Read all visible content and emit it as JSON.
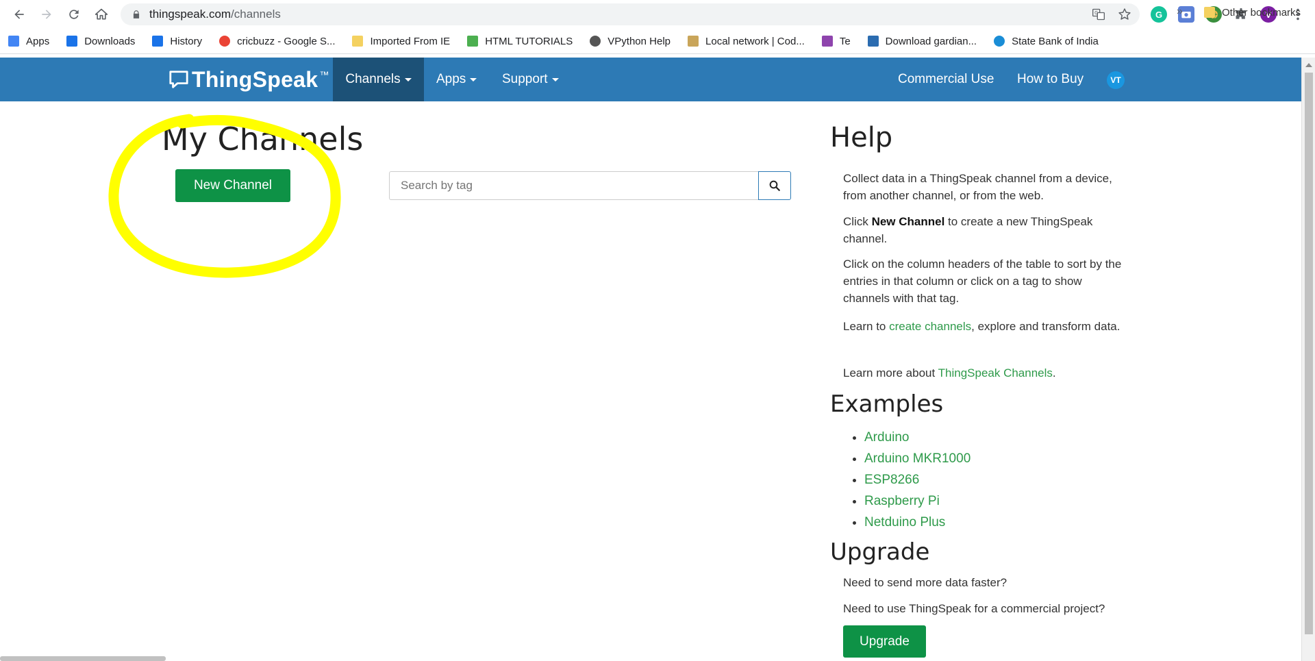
{
  "browser": {
    "url_host": "thingspeak.com",
    "url_path": "/channels",
    "bookmarks": [
      {
        "label": "Apps",
        "icon": "apps-grid-icon",
        "color": "#4285f4"
      },
      {
        "label": "Downloads",
        "icon": "download-icon",
        "color": "#1a73e8"
      },
      {
        "label": "History",
        "icon": "history-icon",
        "color": "#1a73e8"
      },
      {
        "label": "cricbuzz - Google S...",
        "icon": "google-icon",
        "color": "#ea4335"
      },
      {
        "label": "Imported From IE",
        "icon": "folder-icon",
        "color": "#f4d160"
      },
      {
        "label": "HTML TUTORIALS",
        "icon": "w3-icon",
        "color": "#4caf50"
      },
      {
        "label": "VPython Help",
        "icon": "globe-icon",
        "color": "#555555"
      },
      {
        "label": "Local network | Cod...",
        "icon": "crown-icon",
        "color": "#c9a55a"
      },
      {
        "label": "Te",
        "icon": "te-icon",
        "color": "#8e44ad"
      },
      {
        "label": "Download gardian...",
        "icon": "tz-icon",
        "color": "#2b6cb0"
      },
      {
        "label": "State Bank of India",
        "icon": "sbi-icon",
        "color": "#1a8dd6"
      }
    ],
    "more_bookmarks": "»",
    "other_bookmarks": "Other bookmarks",
    "profile_initial": "V"
  },
  "nav": {
    "logo": "ThingSpeak",
    "logo_tm": "™",
    "channels": "Channels",
    "apps": "Apps",
    "support": "Support",
    "commercial_use": "Commercial Use",
    "how_to_buy": "How to Buy",
    "user_initials": "VT",
    "brand_color": "#2d7ab5"
  },
  "main": {
    "title": "My Channels",
    "new_channel_label": "New Channel",
    "search_placeholder": "Search by tag",
    "accent_green": "#0e9246",
    "highlight_color": "#ffff00"
  },
  "help": {
    "title": "Help",
    "p1": "Collect data in a ThingSpeak channel from a device, from another channel, or from the web.",
    "p2_pre": "Click ",
    "p2_bold": "New Channel",
    "p2_post": " to create a new ThingSpeak channel.",
    "p3": "Click on the column headers of the table to sort by the entries in that column or click on a tag to show channels with that tag.",
    "p4_pre": "Learn to ",
    "p4_link": "create channels",
    "p4_post": ", explore and transform data.",
    "p5_pre": "Learn more about ",
    "p5_link": "ThingSpeak Channels",
    "p5_post": ".",
    "examples_title": "Examples",
    "examples": [
      "Arduino",
      "Arduino MKR1000",
      "ESP8266",
      "Raspberry Pi",
      "Netduino Plus"
    ],
    "upgrade_title": "Upgrade",
    "upgrade_q1": "Need to send more data faster?",
    "upgrade_q2": "Need to use ThingSpeak for a commercial project?",
    "upgrade_button": "Upgrade"
  }
}
